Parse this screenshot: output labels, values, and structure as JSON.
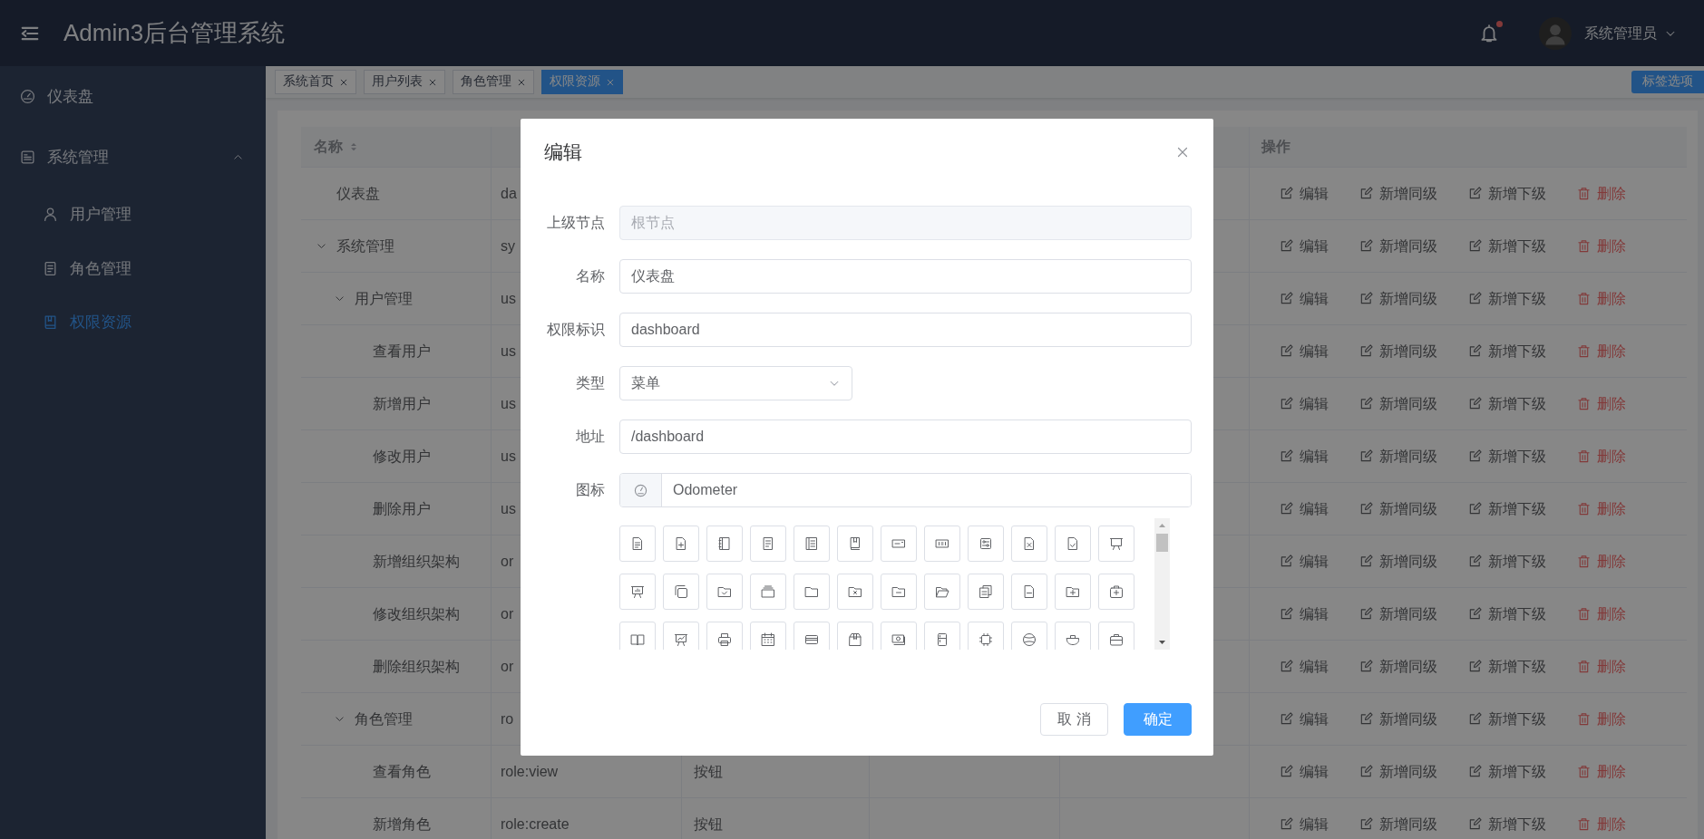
{
  "header": {
    "title": "Admin3后台管理系统",
    "has_unread_notifications": true,
    "user_name": "系统管理员"
  },
  "sidebar": {
    "items": [
      {
        "label": "仪表盘",
        "selected": false
      },
      {
        "label": "系统管理",
        "selected": false,
        "expanded": true,
        "children": [
          {
            "label": "用户管理",
            "selected": false
          },
          {
            "label": "角色管理",
            "selected": false
          },
          {
            "label": "权限资源",
            "selected": true
          }
        ]
      }
    ]
  },
  "tabs": [
    {
      "label": "系统首页",
      "selected": false
    },
    {
      "label": "用户列表",
      "selected": false
    },
    {
      "label": "角色管理",
      "selected": false
    },
    {
      "label": "权限资源",
      "selected": true
    }
  ],
  "tab_options_button": "标签选项",
  "table": {
    "header": {
      "name": {
        "label": "名称",
        "sortable": true
      },
      "actions": {
        "label": "操作"
      }
    },
    "rows": [
      {
        "name": "仪表盘",
        "column_2": "da",
        "actions": [
          {
            "label": "编辑",
            "kind": "edit"
          },
          {
            "label": "新增同级",
            "kind": "edit"
          },
          {
            "label": "新增下级",
            "kind": "edit"
          },
          {
            "label": "删除",
            "kind": "delete"
          }
        ]
      },
      {
        "name": "系统管理",
        "column_2": "sy",
        "expanded": true,
        "actions": [
          {
            "label": "编辑",
            "kind": "edit"
          },
          {
            "label": "新增同级",
            "kind": "edit"
          },
          {
            "label": "新增下级",
            "kind": "edit"
          },
          {
            "label": "删除",
            "kind": "delete"
          }
        ],
        "children": [
          {
            "name": "用户管理",
            "column_2": "us",
            "expanded": true,
            "actions": [
              {
                "label": "编辑",
                "kind": "edit"
              },
              {
                "label": "新增同级",
                "kind": "edit"
              },
              {
                "label": "新增下级",
                "kind": "edit"
              },
              {
                "label": "删除",
                "kind": "delete"
              }
            ],
            "children": [
              {
                "name": "查看用户",
                "column_2": "us",
                "actions": [
                  {
                    "label": "编辑",
                    "kind": "edit"
                  },
                  {
                    "label": "新增同级",
                    "kind": "edit"
                  },
                  {
                    "label": "新增下级",
                    "kind": "edit"
                  },
                  {
                    "label": "删除",
                    "kind": "delete"
                  }
                ]
              },
              {
                "name": "新增用户",
                "column_2": "us",
                "actions": [
                  {
                    "label": "编辑",
                    "kind": "edit"
                  },
                  {
                    "label": "新增同级",
                    "kind": "edit"
                  },
                  {
                    "label": "新增下级",
                    "kind": "edit"
                  },
                  {
                    "label": "删除",
                    "kind": "delete"
                  }
                ]
              },
              {
                "name": "修改用户",
                "column_2": "us",
                "actions": [
                  {
                    "label": "编辑",
                    "kind": "edit"
                  },
                  {
                    "label": "新增同级",
                    "kind": "edit"
                  },
                  {
                    "label": "新增下级",
                    "kind": "edit"
                  },
                  {
                    "label": "删除",
                    "kind": "delete"
                  }
                ]
              },
              {
                "name": "删除用户",
                "column_2": "us",
                "actions": [
                  {
                    "label": "编辑",
                    "kind": "edit"
                  },
                  {
                    "label": "新增同级",
                    "kind": "edit"
                  },
                  {
                    "label": "新增下级",
                    "kind": "edit"
                  },
                  {
                    "label": "删除",
                    "kind": "delete"
                  }
                ]
              },
              {
                "name": "新增组织架构",
                "column_2": "or",
                "actions": [
                  {
                    "label": "编辑",
                    "kind": "edit"
                  },
                  {
                    "label": "新增同级",
                    "kind": "edit"
                  },
                  {
                    "label": "新增下级",
                    "kind": "edit"
                  },
                  {
                    "label": "删除",
                    "kind": "delete"
                  }
                ]
              },
              {
                "name": "修改组织架构",
                "column_2": "or",
                "actions": [
                  {
                    "label": "编辑",
                    "kind": "edit"
                  },
                  {
                    "label": "新增同级",
                    "kind": "edit"
                  },
                  {
                    "label": "新增下级",
                    "kind": "edit"
                  },
                  {
                    "label": "删除",
                    "kind": "delete"
                  }
                ]
              },
              {
                "name": "删除组织架构",
                "column_2": "or",
                "actions": [
                  {
                    "label": "编辑",
                    "kind": "edit"
                  },
                  {
                    "label": "新增同级",
                    "kind": "edit"
                  },
                  {
                    "label": "新增下级",
                    "kind": "edit"
                  },
                  {
                    "label": "删除",
                    "kind": "delete"
                  }
                ]
              }
            ]
          },
          {
            "name": "角色管理",
            "column_2": "ro",
            "expanded": true,
            "actions": [
              {
                "label": "编辑",
                "kind": "edit"
              },
              {
                "label": "新增同级",
                "kind": "edit"
              },
              {
                "label": "新增下级",
                "kind": "edit"
              },
              {
                "label": "删除",
                "kind": "delete"
              }
            ],
            "children": [
              {
                "name": "查看角色",
                "column_2": "role:view",
                "column_3": "按钮",
                "actions": [
                  {
                    "label": "编辑",
                    "kind": "edit"
                  },
                  {
                    "label": "新增同级",
                    "kind": "edit"
                  },
                  {
                    "label": "新增下级",
                    "kind": "edit"
                  },
                  {
                    "label": "删除",
                    "kind": "delete"
                  }
                ]
              },
              {
                "name": "新增角色",
                "column_2": "role:create",
                "column_3": "按钮",
                "actions": [
                  {
                    "label": "编辑",
                    "kind": "edit"
                  },
                  {
                    "label": "新增同级",
                    "kind": "edit"
                  },
                  {
                    "label": "新增下级",
                    "kind": "edit"
                  },
                  {
                    "label": "删除",
                    "kind": "delete"
                  }
                ]
              }
            ]
          }
        ]
      }
    ]
  },
  "dialog": {
    "title": "编辑",
    "fields": [
      {
        "label": "上级节点",
        "kind": "text",
        "value": "根节点",
        "disabled": true
      },
      {
        "label": "名称",
        "kind": "text",
        "value": "仪表盘",
        "disabled": false
      },
      {
        "label": "权限标识",
        "kind": "text",
        "value": "dashboard",
        "disabled": false
      },
      {
        "label": "类型",
        "kind": "select",
        "value": "菜单"
      },
      {
        "label": "地址",
        "kind": "text",
        "value": "/dashboard",
        "disabled": false
      },
      {
        "label": "图标",
        "kind": "icon",
        "value": "Odometer"
      }
    ],
    "buttons": [
      {
        "label": "取 消",
        "kind": "default"
      },
      {
        "label": "确定",
        "kind": "primary"
      }
    ]
  }
}
